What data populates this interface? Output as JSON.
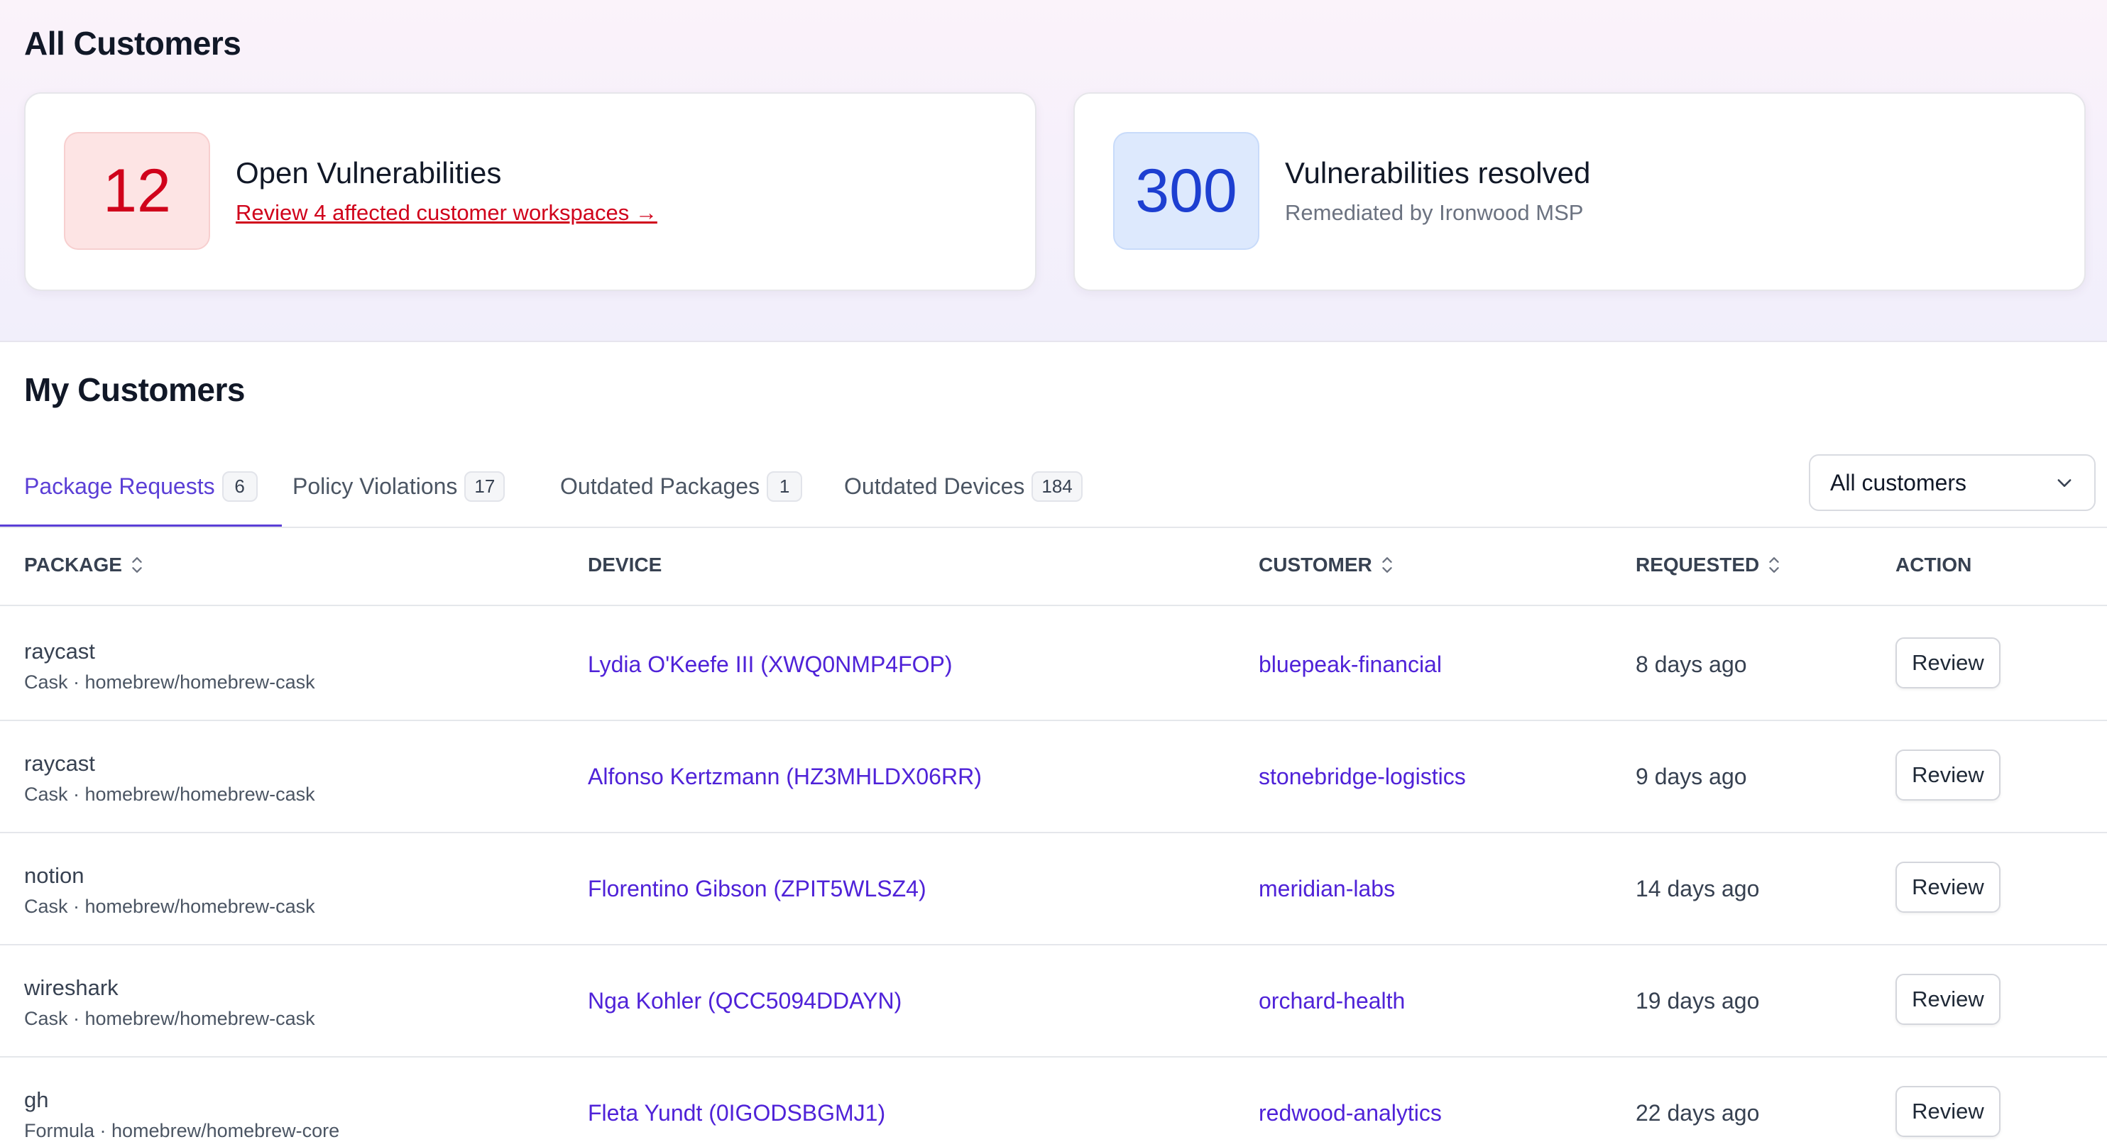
{
  "page": {
    "title": "All Customers"
  },
  "cards": {
    "open": {
      "value": "12",
      "title": "Open Vulnerabilities",
      "link": "Review 4 affected customer workspaces →"
    },
    "resolved": {
      "value": "300",
      "title": "Vulnerabilities resolved",
      "subtitle": "Remediated by Ironwood MSP"
    }
  },
  "section": {
    "title": "My Customers"
  },
  "tabs": [
    {
      "label": "Package Requests",
      "count": "6"
    },
    {
      "label": "Policy Violations",
      "count": "17"
    },
    {
      "label": "Outdated Packages",
      "count": "1"
    },
    {
      "label": "Outdated Devices",
      "count": "184"
    }
  ],
  "filter": {
    "selected": "All customers"
  },
  "table": {
    "headers": {
      "package": "PACKAGE",
      "device": "DEVICE",
      "customer": "CUSTOMER",
      "requested": "REQUESTED",
      "action": "ACTION"
    },
    "rows": [
      {
        "package": "raycast",
        "meta": "Cask · homebrew/homebrew-cask",
        "device": "Lydia O'Keefe III (XWQ0NMP4FOP)",
        "customer": "bluepeak-financial",
        "requested": "8 days ago",
        "action": "Review"
      },
      {
        "package": "raycast",
        "meta": "Cask · homebrew/homebrew-cask",
        "device": "Alfonso Kertzmann (HZ3MHLDX06RR)",
        "customer": "stonebridge-logistics",
        "requested": "9 days ago",
        "action": "Review"
      },
      {
        "package": "notion",
        "meta": "Cask · homebrew/homebrew-cask",
        "device": "Florentino Gibson (ZPIT5WLSZ4)",
        "customer": "meridian-labs",
        "requested": "14 days ago",
        "action": "Review"
      },
      {
        "package": "wireshark",
        "meta": "Cask · homebrew/homebrew-cask",
        "device": "Nga Kohler (QCC5094DDAYN)",
        "customer": "orchard-health",
        "requested": "19 days ago",
        "action": "Review"
      },
      {
        "package": "gh",
        "meta": "Formula · homebrew/homebrew-core",
        "device": "Fleta Yundt (0IGODSBGMJ1)",
        "customer": "redwood-analytics",
        "requested": "22 days ago",
        "action": "Review"
      }
    ]
  }
}
